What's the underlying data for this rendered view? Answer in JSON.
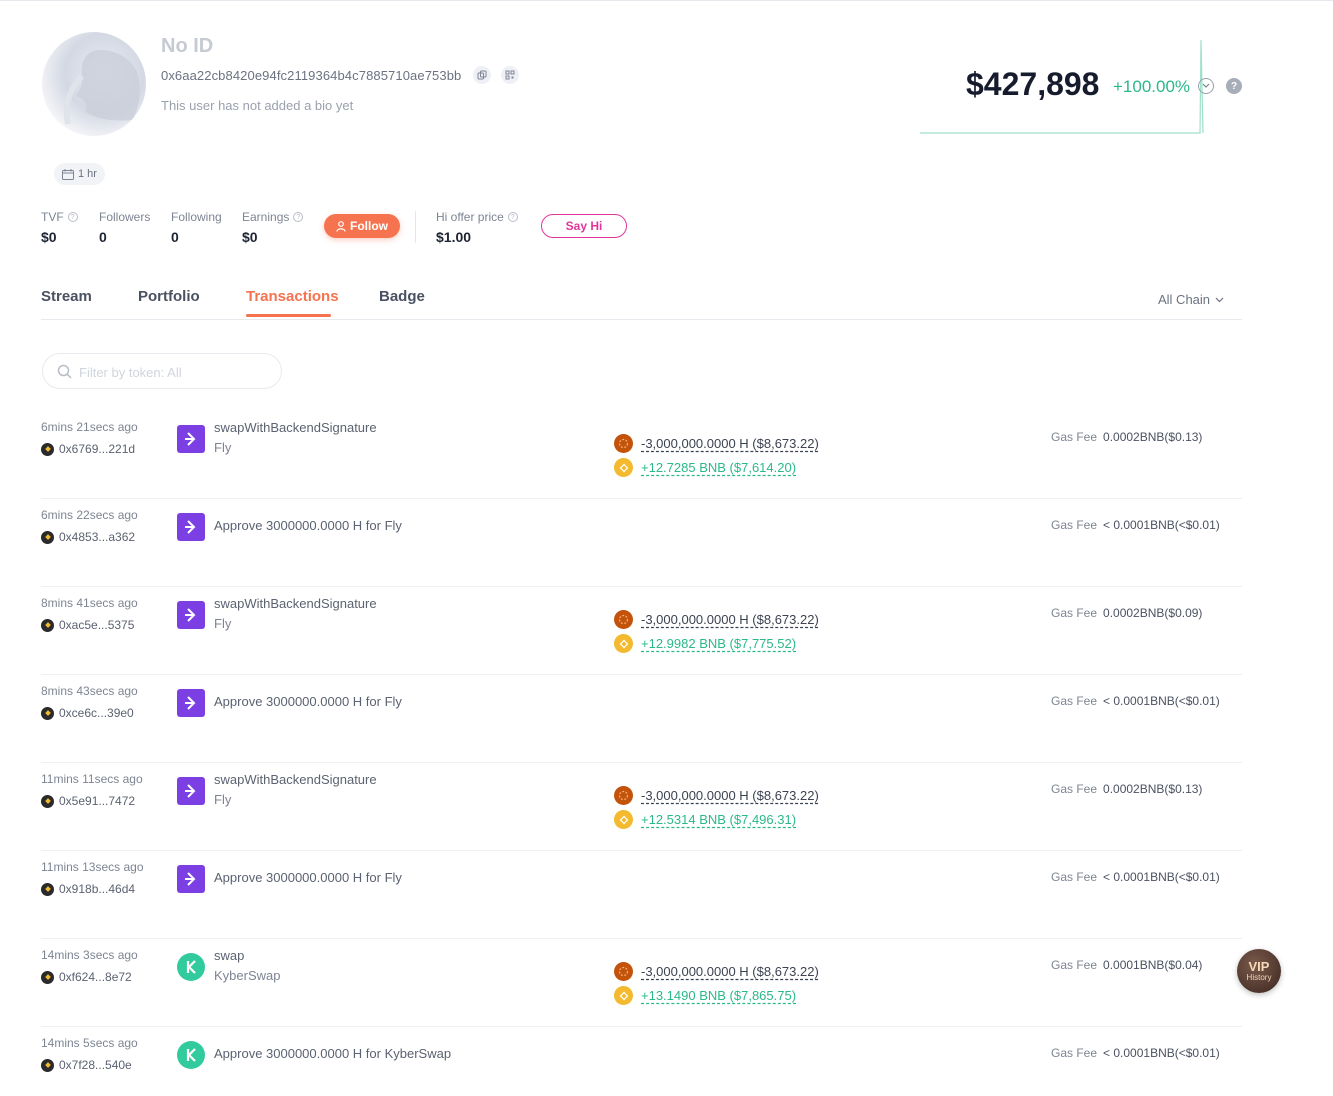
{
  "profile": {
    "name": "No ID",
    "address": "0x6aa22cb8420e94fc2119364b4c7885710ae753bb",
    "bio": "This user has not added a bio yet",
    "age_chip": "1 hr"
  },
  "stats": {
    "tvf": {
      "label": "TVF",
      "value": "$0"
    },
    "followers": {
      "label": "Followers",
      "value": "0"
    },
    "following": {
      "label": "Following",
      "value": "0"
    },
    "earnings": {
      "label": "Earnings",
      "value": "$0"
    },
    "follow_label": "Follow",
    "hi_offer": {
      "label": "Hi offer price",
      "value": "$1.00"
    },
    "sayhi_label": "Say Hi"
  },
  "networth": {
    "value": "$427,898",
    "change": "+100.00%"
  },
  "tabs": [
    {
      "label": "Stream"
    },
    {
      "label": "Portfolio"
    },
    {
      "label": "Transactions"
    },
    {
      "label": "Badge"
    }
  ],
  "chain_filter": "All Chain",
  "search": {
    "placeholder": "Filter by token: All"
  },
  "transactions": [
    {
      "time": "6mins 21secs ago",
      "hash": "0x6769...221d",
      "fn": "swapWithBackendSignature",
      "proto": "Fly",
      "out": "-3,000,000.0000 H ($8,673.22)",
      "in": "+12.7285 BNB ($7,614.20)",
      "gas_label": "Gas Fee",
      "gas": "0.0002BNB($0.13)"
    },
    {
      "time": "6mins 22secs ago",
      "hash": "0x4853...a362",
      "approve": "Approve 3000000.0000 H for Fly",
      "gas_label": "Gas Fee",
      "gas": "< 0.0001BNB(<$0.01)"
    },
    {
      "time": "8mins 41secs ago",
      "hash": "0xac5e...5375",
      "fn": "swapWithBackendSignature",
      "proto": "Fly",
      "out": "-3,000,000.0000 H ($8,673.22)",
      "in": "+12.9982 BNB ($7,775.52)",
      "gas_label": "Gas Fee",
      "gas": "0.0002BNB($0.09)"
    },
    {
      "time": "8mins 43secs ago",
      "hash": "0xce6c...39e0",
      "approve": "Approve 3000000.0000 H for Fly",
      "gas_label": "Gas Fee",
      "gas": "< 0.0001BNB(<$0.01)"
    },
    {
      "time": "11mins 11secs ago",
      "hash": "0x5e91...7472",
      "fn": "swapWithBackendSignature",
      "proto": "Fly",
      "out": "-3,000,000.0000 H ($8,673.22)",
      "in": "+12.5314 BNB ($7,496.31)",
      "gas_label": "Gas Fee",
      "gas": "0.0002BNB($0.13)"
    },
    {
      "time": "11mins 13secs ago",
      "hash": "0x918b...46d4",
      "approve": "Approve 3000000.0000 H for Fly",
      "gas_label": "Gas Fee",
      "gas": "< 0.0001BNB(<$0.01)"
    },
    {
      "time": "14mins 3secs ago",
      "hash": "0xf624...8e72",
      "fn": "swap",
      "proto": "KyberSwap",
      "out": "-3,000,000.0000 H ($8,673.22)",
      "in": "+13.1490 BNB ($7,865.75)",
      "gas_label": "Gas Fee",
      "gas": "0.0001BNB($0.04)"
    },
    {
      "time": "14mins 5secs ago",
      "hash": "0x7f28...540e",
      "approve": "Approve 3000000.0000 H for KyberSwap",
      "gas_label": "Gas Fee",
      "gas": "< 0.0001BNB(<$0.01)"
    }
  ],
  "vip": {
    "title": "VIP",
    "sub": "History"
  },
  "colors": {
    "accent": "#f5734f",
    "positive": "#2bb88a",
    "sayhi": "#e0369b",
    "fly": "#7b3fe4",
    "kyber": "#31cb9e"
  }
}
